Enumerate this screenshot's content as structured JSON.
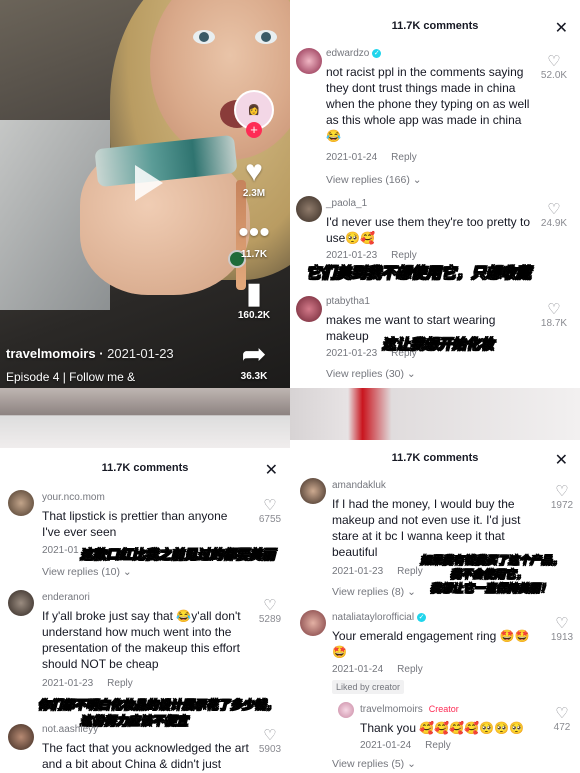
{
  "video": {
    "username": "travelmomoirs",
    "date": "2021-01-23",
    "description": "Episode 4 | Follow me &",
    "likes": "2.3M",
    "comments": "11.7K",
    "saves": "160.2K",
    "shares": "36.3K",
    "icons": [
      "heart-icon",
      "comment-icon",
      "bookmark-icon",
      "share-icon"
    ]
  },
  "panel_tr": {
    "title": "11.7K comments",
    "comments": [
      {
        "user": "edwardzo",
        "verified": true,
        "text": "not racist ppl in the comments saying they dont trust things made in china when the phone they typing on as well as this whole app was made in china 😂",
        "date": "2021-01-24",
        "reply": "Reply",
        "view_replies": "View replies (166)",
        "likes": "52.0K"
      },
      {
        "user": "_paola_1",
        "text": "I'd never use them they're too pretty to use🥺🥰",
        "date": "2021-01-23",
        "reply": "Reply",
        "likes": "24.9K"
      },
      {
        "user": "ptabytha1",
        "text": "makes me want to start wearing makeup",
        "date": "2021-01-23",
        "reply": "Reply",
        "view_replies": "View replies (30)",
        "likes": "18.7K"
      }
    ],
    "overlay1": "它们美到我不想使用它，只想收藏",
    "overlay2": "这让我想开始化妆"
  },
  "panel_bl": {
    "title": "11.7K comments",
    "comments": [
      {
        "user": "your.nco.mom",
        "text": "That lipstick is prettier than anyone I've ever seen",
        "date": "2021-01",
        "view_replies": "View replies (10)",
        "likes": "6755"
      },
      {
        "user": "enderanori",
        "text": "If y'all broke just say that 😂y'all don't understand how much went into the presentation of the makeup this effort should NOT be cheap",
        "date": "2021-01-23",
        "reply": "Reply",
        "likes": "5289"
      },
      {
        "user": "not.aashleyy",
        "text": "The fact that you acknowledged the art and a bit about China & didn't just",
        "likes": "5903"
      }
    ],
    "overlay1": "这款口红比我之前见过的都要美丽",
    "overlay2a": "你们都不明白化妆品的设计展示花了多少钱，",
    "overlay2b": "这份努力应该不便宜"
  },
  "panel_br": {
    "title": "11.7K comments",
    "comments": [
      {
        "user": "amandakluk",
        "text": "If I had the money, I would buy the makeup and not even use it. I'd just stare at it bc I wanna keep it that beautiful",
        "date": "2021-01-23",
        "reply": "Reply",
        "view_replies": "View replies (8)",
        "likes": "1972"
      },
      {
        "user": "nataliataylorofficial",
        "verified": true,
        "text": "Your emerald engagement ring 🤩🤩🤩",
        "date": "2021-01-24",
        "reply": "Reply",
        "liked": "Liked by creator",
        "likes": "1913"
      },
      {
        "user": "travelmomoirs",
        "creator": "Creator",
        "text": "Thank you 🥰🥰🥰🥰🥺🥺🥺",
        "date": "2021-01-24",
        "reply": "Reply",
        "likes": "472"
      }
    ],
    "view_replies_bottom": "View replies (5)",
    "overlay1a": "如果我有钱我买了这个产品，",
    "overlay1b": "我不会使用它，",
    "overlay1c": "我想让它一直保持美丽！"
  }
}
